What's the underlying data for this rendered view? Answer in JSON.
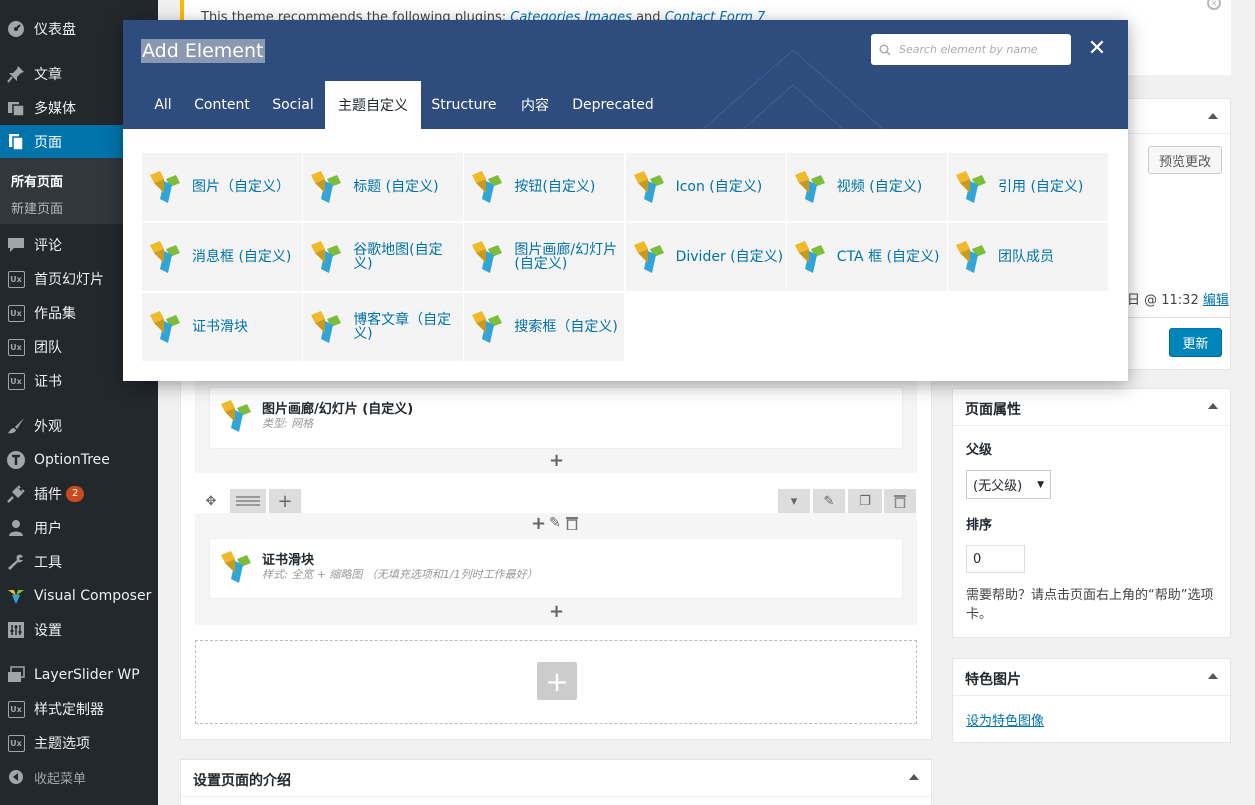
{
  "sidebar": {
    "items": [
      {
        "label": "仪表盘"
      },
      {
        "label": "文章"
      },
      {
        "label": "多媒体"
      },
      {
        "label": "页面"
      },
      {
        "label": "评论"
      },
      {
        "label": "首页幻灯片"
      },
      {
        "label": "作品集"
      },
      {
        "label": "团队"
      },
      {
        "label": "证书"
      },
      {
        "label": "外观"
      },
      {
        "label": "OptionTree"
      },
      {
        "label": "插件",
        "badge": "2"
      },
      {
        "label": "用户"
      },
      {
        "label": "工具"
      },
      {
        "label": "Visual Composer"
      },
      {
        "label": "设置"
      },
      {
        "label": "LayerSlider WP"
      },
      {
        "label": "样式定制器"
      },
      {
        "label": "主题选项"
      }
    ],
    "submenu": [
      "所有页面",
      "新建页面"
    ],
    "collapse": "收起菜单"
  },
  "notice": {
    "text": "This theme recommends the following plugins:",
    "plugin1": "Categories Images",
    "and": "and",
    "plugin2": "Contact Form 7"
  },
  "publish": {
    "preview_button": "预览更改",
    "date_text": "日 @ 11:32",
    "edit_link": "编辑",
    "update_button": "更新"
  },
  "page_attributes": {
    "title": "页面属性",
    "parent_label": "父级",
    "parent_value": "(无父级)",
    "order_label": "排序",
    "order_value": "0",
    "help": "需要帮助？请点击页面右上角的“帮助”选项卡。"
  },
  "featured_image": {
    "title": "特色图片",
    "link": "设为特色图像"
  },
  "page_intro": {
    "title": "设置页面的介绍"
  },
  "builder": {
    "element1": {
      "title": "图片画廊/幻灯片 (自定义)",
      "sub": "类型: 网格"
    },
    "element2": {
      "title": "证书滑块",
      "sub": "样式: 全宽 + 缩略图 （无填充选项和1/1列时工作最好）"
    }
  },
  "modal": {
    "title": "Add Element",
    "search_placeholder": "Search element by name",
    "tabs": [
      "All",
      "Content",
      "Social",
      "主题自定义",
      "Structure",
      "内容",
      "Deprecated"
    ],
    "active_tab": "主题自定义",
    "elements": [
      "图片（自定义）",
      "标题 (自定义)",
      "按钮(自定义)",
      "Icon (自定义)",
      "视频 (自定义)",
      "引用 (自定义)",
      "消息框 (自定义)",
      "谷歌地图(自定义)",
      "图片画廊/幻灯片(自定义)",
      "Divider (自定义)",
      "CTA 框 (自定义)",
      "团队成员",
      "证书滑块",
      "博客文章（自定义)",
      "搜索框（自定义)"
    ]
  },
  "colors": {
    "sidebar_bg": "#23282d",
    "accent": "#0073aa",
    "modal_header": "#2e4c7e",
    "notice_border": "#ffb900"
  }
}
